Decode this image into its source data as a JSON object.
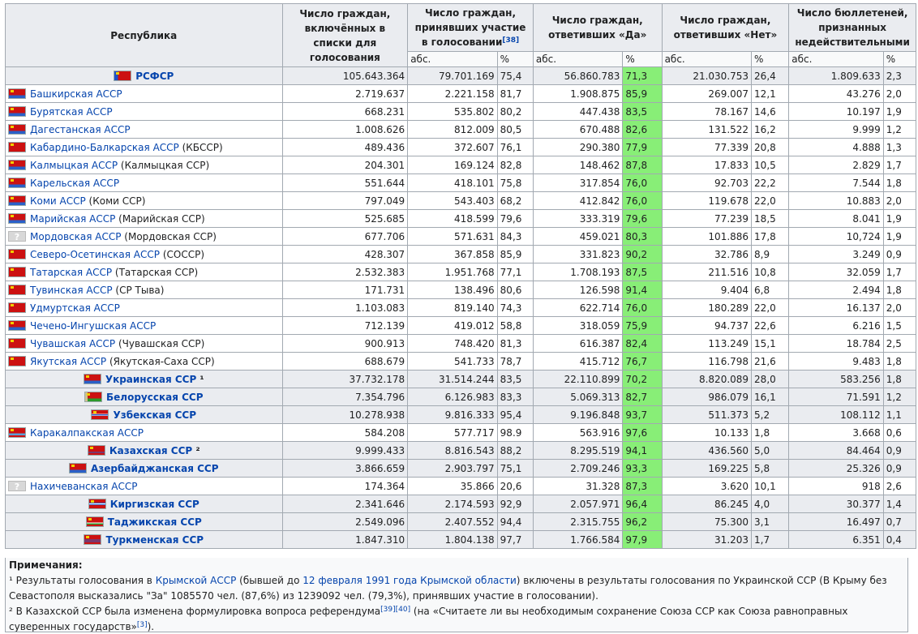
{
  "headers": {
    "republic": "Республика",
    "listed": "Число граждан, включённых в списки для голосования",
    "voted": "Число граждан, принявших участие в голосовании",
    "voted_ref": "[38]",
    "yes": "Число граждан, ответивших «Да»",
    "no": "Число граждан, ответивших «Нет»",
    "invalid": "Число бюллетеней, признанных недействительными",
    "abs": "абс.",
    "pct": "%"
  },
  "rows": [
    {
      "type": "ssr",
      "flag": "rsfsr",
      "name": "РСФСР",
      "note": "",
      "listed": "105.643.364",
      "voted": "79.701.169",
      "voted_pct": "75,4",
      "yes": "56.860.783",
      "yes_pct": "71,3",
      "no": "21.030.753",
      "no_pct": "26,4",
      "inv": "1.809.633",
      "inv_pct": "2,3"
    },
    {
      "type": "asr",
      "flag": "asr",
      "name": "Башкирская АССР",
      "note": "",
      "listed": "2.719.637",
      "voted": "2.221.158",
      "voted_pct": "81,7",
      "yes": "1.908.875",
      "yes_pct": "85,9",
      "no": "269.007",
      "no_pct": "12,1",
      "inv": "43.276",
      "inv_pct": "2,0"
    },
    {
      "type": "asr",
      "flag": "asr",
      "name": "Бурятская АССР",
      "note": "",
      "listed": "668.231",
      "voted": "535.802",
      "voted_pct": "80,2",
      "yes": "447.438",
      "yes_pct": "83,5",
      "no": "78.167",
      "no_pct": "14,6",
      "inv": "10.197",
      "inv_pct": "1,9"
    },
    {
      "type": "asr",
      "flag": "asr",
      "name": "Дагестанская АССР",
      "note": "",
      "listed": "1.008.626",
      "voted": "812.009",
      "voted_pct": "80,5",
      "yes": "670.488",
      "yes_pct": "82,6",
      "no": "131.522",
      "no_pct": "16,2",
      "inv": "9.999",
      "inv_pct": "1,2"
    },
    {
      "type": "asr",
      "flag": "asr2",
      "name": "Кабардино-Балкарская АССР",
      "note": " (КБССР)",
      "listed": "489.436",
      "voted": "372.607",
      "voted_pct": "76,1",
      "yes": "290.380",
      "yes_pct": "77,9",
      "no": "77.339",
      "no_pct": "20,8",
      "inv": "4.888",
      "inv_pct": "1,3"
    },
    {
      "type": "asr",
      "flag": "asr",
      "name": "Калмыцкая АССР",
      "note": " (Калмыцкая ССР)",
      "listed": "204.301",
      "voted": "169.124",
      "voted_pct": "82,8",
      "yes": "148.462",
      "yes_pct": "87,8",
      "no": "17.833",
      "no_pct": "10,5",
      "inv": "2.829",
      "inv_pct": "1,7"
    },
    {
      "type": "asr",
      "flag": "asr",
      "name": "Карельская АССР",
      "note": "",
      "listed": "551.644",
      "voted": "418.101",
      "voted_pct": "75,8",
      "yes": "317.854",
      "yes_pct": "76,0",
      "no": "92.703",
      "no_pct": "22,2",
      "inv": "7.544",
      "inv_pct": "1,8"
    },
    {
      "type": "asr",
      "flag": "asr",
      "name": "Коми АССР",
      "note": " (Коми ССР)",
      "listed": "797.049",
      "voted": "543.403",
      "voted_pct": "68,2",
      "yes": "412.842",
      "yes_pct": "76,0",
      "no": "119.678",
      "no_pct": "22,0",
      "inv": "10.883",
      "inv_pct": "2,0"
    },
    {
      "type": "asr",
      "flag": "asr",
      "name": "Марийская АССР",
      "note": " (Марийская ССР)",
      "listed": "525.685",
      "voted": "418.599",
      "voted_pct": "79,6",
      "yes": "333.319",
      "yes_pct": "79,6",
      "no": "77.239",
      "no_pct": "18,5",
      "inv": "8.041",
      "inv_pct": "1,9"
    },
    {
      "type": "asr",
      "flag": "unknown",
      "name": "Мордовская АССР",
      "note": " (Мордовская ССР)",
      "listed": "677.706",
      "voted": "571.631",
      "voted_pct": "84,3",
      "yes": "459.021",
      "yes_pct": "80,3",
      "no": "101.886",
      "no_pct": "17,8",
      "inv": "10,724",
      "inv_pct": "1,9"
    },
    {
      "type": "asr",
      "flag": "asr2",
      "name": "Северо-Осетинская АССР",
      "note": " (СОССР)",
      "listed": "428.307",
      "voted": "367.858",
      "voted_pct": "85,9",
      "yes": "331.823",
      "yes_pct": "90,2",
      "no": "32.786",
      "no_pct": "8,9",
      "inv": "3.249",
      "inv_pct": "0,9"
    },
    {
      "type": "asr",
      "flag": "asr2",
      "name": "Татарская АССР",
      "note": " (Татарская ССР)",
      "listed": "2.532.383",
      "voted": "1.951.768",
      "voted_pct": "77,1",
      "yes": "1.708.193",
      "yes_pct": "87,5",
      "no": "211.516",
      "no_pct": "10,8",
      "inv": "32.059",
      "inv_pct": "1,7"
    },
    {
      "type": "asr",
      "flag": "asr2",
      "name": "Тувинская АССР",
      "note": " (СР Тыва)",
      "listed": "171.731",
      "voted": "138.496",
      "voted_pct": "80,6",
      "yes": "126.598",
      "yes_pct": "91,4",
      "no": "9.404",
      "no_pct": "6,8",
      "inv": "2.494",
      "inv_pct": "1,8"
    },
    {
      "type": "asr",
      "flag": "asr2",
      "name": "Удмуртская АССР",
      "note": "",
      "listed": "1.103.083",
      "voted": "819.140",
      "voted_pct": "74,3",
      "yes": "622.714",
      "yes_pct": "76,0",
      "no": "180.289",
      "no_pct": "22,0",
      "inv": "16.137",
      "inv_pct": "2,0"
    },
    {
      "type": "asr",
      "flag": "asr",
      "name": "Чечено-Ингушская АССР",
      "note": "",
      "listed": "712.139",
      "voted": "419.012",
      "voted_pct": "58,8",
      "yes": "318.059",
      "yes_pct": "75,9",
      "no": "94.737",
      "no_pct": "22,6",
      "inv": "6.216",
      "inv_pct": "1,5"
    },
    {
      "type": "asr",
      "flag": "asr2",
      "name": "Чувашская АССР",
      "note": " (Чувашская ССР)",
      "listed": "900.913",
      "voted": "748.420",
      "voted_pct": "81,3",
      "yes": "616.387",
      "yes_pct": "82,4",
      "no": "113.249",
      "no_pct": "15,1",
      "inv": "18.784",
      "inv_pct": "2,5"
    },
    {
      "type": "asr",
      "flag": "asr2",
      "name": "Якутская АССР",
      "note": " (Якутская-Саха ССР)",
      "listed": "688.679",
      "voted": "541.733",
      "voted_pct": "78,7",
      "yes": "415.712",
      "yes_pct": "76,7",
      "no": "116.798",
      "no_pct": "21,6",
      "inv": "9.483",
      "inv_pct": "1,8"
    },
    {
      "type": "ssr",
      "flag": "ukr",
      "name": "Украинская ССР",
      "note": " ¹",
      "listed": "37.732.178",
      "voted": "31.514.244",
      "voted_pct": "83,5",
      "yes": "22.110.899",
      "yes_pct": "70,2",
      "no": "8.820.089",
      "no_pct": "28,0",
      "inv": "583.256",
      "inv_pct": "1,8"
    },
    {
      "type": "ssr",
      "flag": "bel",
      "name": "Белорусская ССР",
      "note": "",
      "listed": "7.354.796",
      "voted": "6.126.983",
      "voted_pct": "83,3",
      "yes": "5.069.313",
      "yes_pct": "82,7",
      "no": "986.079",
      "no_pct": "16,1",
      "inv": "71.591",
      "inv_pct": "1,2"
    },
    {
      "type": "ssr",
      "flag": "uzb",
      "name": "Узбекская ССР",
      "note": "",
      "listed": "10.278.938",
      "voted": "9.816.333",
      "voted_pct": "95,4",
      "yes": "9.196.848",
      "yes_pct": "93,7",
      "no": "511.373",
      "no_pct": "5,2",
      "inv": "108.112",
      "inv_pct": "1,1"
    },
    {
      "type": "asr",
      "flag": "kk",
      "name": "Каракалпакская АССР",
      "note": "",
      "listed": "584.208",
      "voted": "577.717",
      "voted_pct": "98.9",
      "yes": "563.916",
      "yes_pct": "97,6",
      "no": "10.133",
      "no_pct": "1,8",
      "inv": "3.668",
      "inv_pct": "0,6"
    },
    {
      "type": "ssr",
      "flag": "kaz",
      "name": "Казахская ССР",
      "note": " ²",
      "listed": "9.999.433",
      "voted": "8.816.543",
      "voted_pct": "88,2",
      "yes": "8.295.519",
      "yes_pct": "94,1",
      "no": "436.560",
      "no_pct": "5,0",
      "inv": "84.464",
      "inv_pct": "0,9"
    },
    {
      "type": "ssr",
      "flag": "aze",
      "name": "Азербайджанская ССР",
      "note": "",
      "listed": "3.866.659",
      "voted": "2.903.797",
      "voted_pct": "75,1",
      "yes": "2.709.246",
      "yes_pct": "93,3",
      "no": "169.225",
      "no_pct": "5,8",
      "inv": "25.326",
      "inv_pct": "0,9"
    },
    {
      "type": "asr",
      "flag": "unknown",
      "name": "Нахичеванская АССР",
      "note": "",
      "listed": "174.364",
      "voted": "35.866",
      "voted_pct": "20,6",
      "yes": "31.328",
      "yes_pct": "87,3",
      "no": "3.620",
      "no_pct": "10,1",
      "inv": "918",
      "inv_pct": "2,6"
    },
    {
      "type": "ssr",
      "flag": "kir",
      "name": "Киргизская ССР",
      "note": "",
      "listed": "2.341.646",
      "voted": "2.174.593",
      "voted_pct": "92,9",
      "yes": "2.057.971",
      "yes_pct": "96,4",
      "no": "86.245",
      "no_pct": "4,0",
      "inv": "30.377",
      "inv_pct": "1,4"
    },
    {
      "type": "ssr",
      "flag": "taj",
      "name": "Таджикская ССР",
      "note": "",
      "listed": "2.549.096",
      "voted": "2.407.552",
      "voted_pct": "94,4",
      "yes": "2.315.755",
      "yes_pct": "96,2",
      "no": "75.300",
      "no_pct": "3,1",
      "inv": "16.497",
      "inv_pct": "0,7"
    },
    {
      "type": "ssr",
      "flag": "turk",
      "name": "Туркменская ССР",
      "note": "",
      "listed": "1.847.310",
      "voted": "1.804.138",
      "voted_pct": "97,7",
      "yes": "1.766.584",
      "yes_pct": "97,9",
      "no": "31.203",
      "no_pct": "1,7",
      "inv": "6.351",
      "inv_pct": "0,4"
    }
  ],
  "notes": {
    "title": "Примечания:",
    "n1_a": "¹ Результаты голосования в ",
    "n1_link1": "Крымской АССР",
    "n1_b": " (бывшей до ",
    "n1_link2": "12 февраля 1991 года Крымской области",
    "n1_c": ") включены в результаты голосования по Украинской ССР (В Крыму без Севастополя высказались \"За\" 1085570 чел. (87,6%) из 1239092 чел. (79,3%), принявших участие в голосовании).",
    "n2_a": "² В Казахской ССР была изменена формулировка вопроса референдума",
    "n2_ref": "[39][40]",
    "n2_b": " (на «Считаете ли вы необходимым сохранение Союза ССР как Союза равноправных суверенных государств»",
    "n2_ref2": "[3]",
    "n2_c": ")."
  }
}
